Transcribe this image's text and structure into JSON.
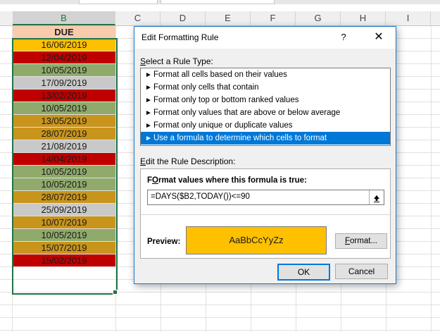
{
  "sheet": {
    "columns": [
      "B",
      "C",
      "D",
      "E",
      "F",
      "G",
      "H",
      "I"
    ],
    "selected_column": "B",
    "header": "DUE",
    "rows": [
      {
        "date": "16/06/2019",
        "fill": "#ffc000"
      },
      {
        "date": "12/04/2019",
        "fill": "#c00000"
      },
      {
        "date": "10/05/2019",
        "fill": "#8faa6b"
      },
      {
        "date": "17/09/2019",
        "fill": "#c9c9c9"
      },
      {
        "date": "13/02/2019",
        "fill": "#c00000"
      },
      {
        "date": "10/05/2019",
        "fill": "#8faa6b"
      },
      {
        "date": "13/05/2019",
        "fill": "#c8941c"
      },
      {
        "date": "28/07/2019",
        "fill": "#c8941c"
      },
      {
        "date": "21/08/2019",
        "fill": "#c9c9c9"
      },
      {
        "date": "14/04/2019",
        "fill": "#c00000"
      },
      {
        "date": "10/05/2019",
        "fill": "#8faa6b"
      },
      {
        "date": "10/05/2019",
        "fill": "#8faa6b"
      },
      {
        "date": "28/07/2019",
        "fill": "#c8941c"
      },
      {
        "date": "25/09/2019",
        "fill": "#c9c9c9"
      },
      {
        "date": "10/07/2019",
        "fill": "#c8941c"
      },
      {
        "date": "10/05/2019",
        "fill": "#8faa6b"
      },
      {
        "date": "15/07/2019",
        "fill": "#c8941c"
      },
      {
        "date": "15/02/2019",
        "fill": "#c00000"
      }
    ]
  },
  "dialog": {
    "title": "Edit Formatting Rule",
    "help_label": "?",
    "close_label": "✕",
    "rule_type_label_hotkey": "S",
    "rule_type_label_rest": "elect a Rule Type:",
    "rule_types": [
      "Format all cells based on their values",
      "Format only cells that contain",
      "Format only top or bottom ranked values",
      "Format only values that are above or below average",
      "Format only unique or duplicate values",
      "Use a formula to determine which cells to format"
    ],
    "selected_rule_index": 5,
    "description_label_hotkey": "E",
    "description_label_rest": "dit the Rule Description:",
    "formula_label_hotkey": "O",
    "formula_label_pre": "F",
    "formula_label_rest": "rmat values where this formula is true:",
    "formula_value": "=DAYS($B2,TODAY())<=90",
    "preview_label": "Preview:",
    "preview_text": "AaBbCcYyZz",
    "preview_fill": "#ffc000",
    "format_button_hotkey": "F",
    "format_button_rest": "ormat...",
    "ok_label": "OK",
    "cancel_label": "Cancel"
  },
  "colors": {
    "accent": "#0078d7",
    "excel_green": "#217346"
  }
}
